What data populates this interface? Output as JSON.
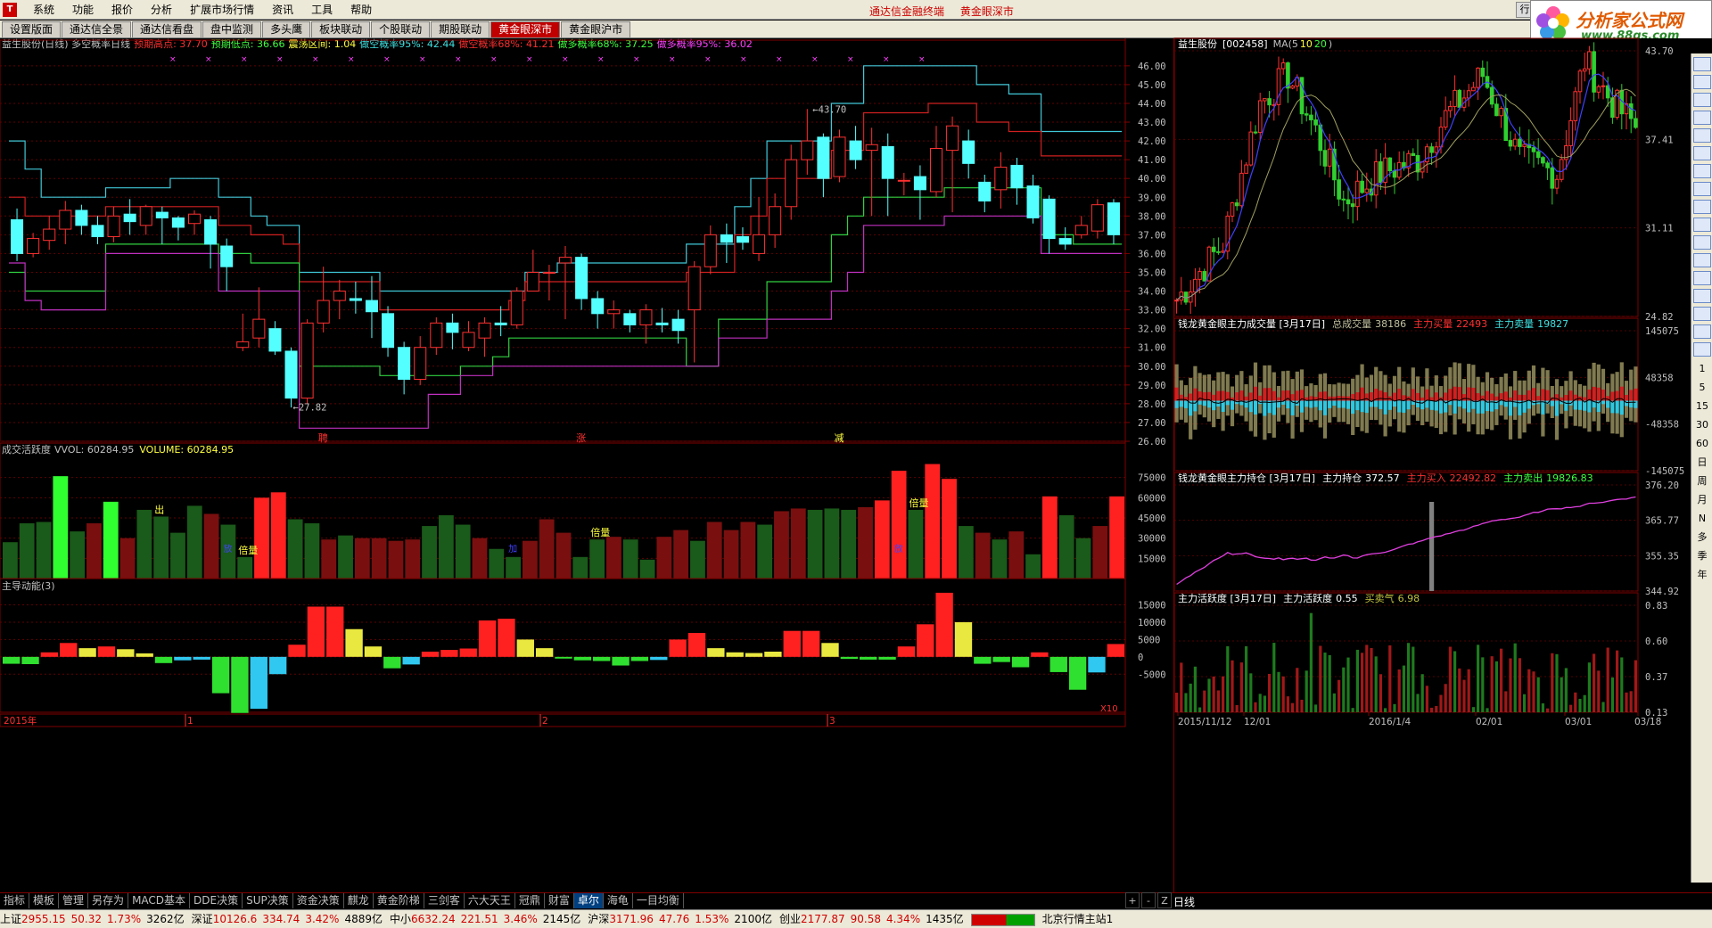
{
  "window": {
    "menus": [
      "系统",
      "功能",
      "报价",
      "分析",
      "扩展市场行情",
      "资讯",
      "工具",
      "帮助"
    ],
    "center_titles": [
      "通达信金融终端",
      "黄金眼深市"
    ],
    "win_buttons": [
      "行",
      "—",
      "□",
      "×"
    ]
  },
  "logo": {
    "text": "分析家公式网",
    "url": "www.88gs.com"
  },
  "tabs": [
    "设置版面",
    "通达信全景",
    "通达信看盘",
    "盘中监测",
    "多头鹰",
    "板块联动",
    "个股联动",
    "期股联动",
    "黄金眼深市",
    "黄金眼沪市"
  ],
  "active_tab": 8,
  "main_header": {
    "title": "益生股份(日线) 多空概率日线",
    "items": [
      {
        "text": "预期高点: 37.70",
        "color": "#ff3030"
      },
      {
        "text": "预期低点: 36.66",
        "color": "#40ff40"
      },
      {
        "text": "震荡区间: 1.04",
        "color": "#ffff40"
      },
      {
        "text": "做空概率95%: 42.44",
        "color": "#40e0e0"
      },
      {
        "text": "做空概率68%: 41.21",
        "color": "#ff3030"
      },
      {
        "text": "做多概率68%: 37.25",
        "color": "#40ff40"
      },
      {
        "text": "做多概率95%: 36.02",
        "color": "#ff40ff"
      }
    ]
  },
  "price_axis": [
    "46.00",
    "45.00",
    "44.00",
    "43.00",
    "42.00",
    "41.00",
    "40.00",
    "39.00",
    "38.00",
    "37.00",
    "36.00",
    "35.00",
    "34.00",
    "33.00",
    "32.00",
    "31.00",
    "30.00",
    "29.00",
    "28.00",
    "27.00",
    "26.00"
  ],
  "price_annot": {
    "high": "43.70",
    "low": "27.82"
  },
  "main_marks": [
    "聘",
    "涨",
    "减"
  ],
  "vol_header": {
    "title": "成交活跃度",
    "vvol": "VVOL: 60284.95",
    "volume": "VOLUME: 60284.95"
  },
  "vol_axis": [
    "75000",
    "60000",
    "45000",
    "30000",
    "15000"
  ],
  "vol_labels": [
    "出",
    "倍量",
    "倍量",
    "倍量"
  ],
  "vol_side_labels": [
    "放",
    "加",
    "放"
  ],
  "ind_header": {
    "title": "主导动能(3)"
  },
  "ind_axis": [
    "15000",
    "10000",
    "5000",
    "0",
    "-5000"
  ],
  "x_axis": {
    "labels": [
      "2015年",
      "1",
      "2",
      "3"
    ],
    "corner": "X10"
  },
  "bottom_tabs": [
    "指标",
    "模板",
    "管理",
    "另存为",
    "MACD基本",
    "DDE决策",
    "SUP决策",
    "资金决策",
    "麒龙",
    "黄金阶梯",
    "三剑客",
    "六大天王",
    "冠鼎",
    "财富",
    "卓尔",
    "海龟",
    "一目均衡"
  ],
  "bottom_active": 14,
  "bottom_ctrl": [
    "+",
    "-",
    "Z"
  ],
  "period_label": "日线",
  "right": {
    "p1_header": {
      "name": "益生股份",
      "code": "[002458]",
      "ma": "MA(",
      "ma5": "5",
      "ma10": "10",
      "ma20": "20",
      "close": ")"
    },
    "p1_axis": [
      "43.70",
      "37.41",
      "31.11",
      "24.82"
    ],
    "p2_header": {
      "title": "钱龙黄金眼主力成交量 [3月17日]",
      "total_label": "总成交量",
      "total": "38186",
      "buy_label": "主力买量",
      "buy": "22493",
      "sell_label": "主力卖量",
      "sell": "19827"
    },
    "p2_axis": [
      "145075",
      "48358",
      "-48358",
      "-145075"
    ],
    "p3_header": {
      "title": "钱龙黄金眼主力持仓 [3月17日]",
      "hold_label": "主力持仓",
      "hold": "372.57",
      "buy_label": "主力买入",
      "buy": "22492.82",
      "sell_label": "主力卖出",
      "sell": "19826.83"
    },
    "p3_axis": [
      "376.20",
      "365.77",
      "355.35",
      "344.92"
    ],
    "p4_header": {
      "title": "主力活跃度 [3月17日]",
      "act_label": "主力活跃度",
      "act": "0.55",
      "bs_label": "买卖气",
      "bs": "6.98"
    },
    "p4_axis": [
      "0.83",
      "0.60",
      "0.37",
      "0.13"
    ],
    "x_axis": [
      "2015/11/12",
      "12/01",
      "2016/1/4",
      "02/01",
      "03/01",
      "03/18"
    ]
  },
  "sidebar_periods": [
    "1",
    "5",
    "15",
    "30",
    "60",
    "日",
    "周",
    "月",
    "N",
    "多",
    "季",
    "年"
  ],
  "status": {
    "items": [
      {
        "name": "上证",
        "val": "2955.15",
        "chg": "50.32",
        "pct": "1.73%",
        "amt": "3262亿"
      },
      {
        "name": "深证",
        "val": "10126.6",
        "chg": "334.74",
        "pct": "3.42%",
        "amt": "4889亿"
      },
      {
        "name": "中小",
        "val": "6632.24",
        "chg": "221.51",
        "pct": "3.46%",
        "amt": "2145亿"
      },
      {
        "name": "沪深",
        "val": "3171.96",
        "chg": "47.76",
        "pct": "1.53%",
        "amt": "2100亿"
      },
      {
        "name": "创业",
        "val": "2177.87",
        "chg": "90.58",
        "pct": "4.34%",
        "amt": "1435亿"
      }
    ],
    "station": "北京行情主站1"
  },
  "colors": {
    "up": "#ff3030",
    "down": "#54ffff",
    "frame": "#800000",
    "grid": "#800000"
  },
  "chart_data": [
    {
      "type": "candlestick",
      "title": "益生股份(日线) 多空概率日线",
      "ylim": [
        26,
        46
      ],
      "candles": [
        [
          37.8,
          36.0,
          38.4,
          35.6
        ],
        [
          36.0,
          36.8,
          37.1,
          35.8
        ],
        [
          36.7,
          37.3,
          38.0,
          36.2
        ],
        [
          37.3,
          38.3,
          38.8,
          36.5
        ],
        [
          38.3,
          37.5,
          38.6,
          37.0
        ],
        [
          37.5,
          36.9,
          38.0,
          36.5
        ],
        [
          36.9,
          38.0,
          38.5,
          36.6
        ],
        [
          38.1,
          37.7,
          38.9,
          37.0
        ],
        [
          37.5,
          38.5,
          38.6,
          37.0
        ],
        [
          38.2,
          37.9,
          38.5,
          36.5
        ],
        [
          37.9,
          37.4,
          38.0,
          36.7
        ],
        [
          37.6,
          38.1,
          38.3,
          37.0
        ],
        [
          37.8,
          36.5,
          38.0,
          35.2
        ],
        [
          36.4,
          35.3,
          36.8,
          34.0
        ],
        [
          31.0,
          31.3,
          32.8,
          30.8
        ],
        [
          31.5,
          32.5,
          34.2,
          31.0
        ],
        [
          32.0,
          30.8,
          32.4,
          30.6
        ],
        [
          30.8,
          28.3,
          31.0,
          27.8
        ],
        [
          28.3,
          32.3,
          32.5,
          28.0
        ],
        [
          32.3,
          33.5,
          35.3,
          31.8
        ],
        [
          33.5,
          34.0,
          34.6,
          32.5
        ],
        [
          33.6,
          33.5,
          34.5,
          32.8
        ],
        [
          33.5,
          32.9,
          34.8,
          31.5
        ],
        [
          32.8,
          31.0,
          33.2,
          30.5
        ],
        [
          31.0,
          29.3,
          31.3,
          28.5
        ],
        [
          29.3,
          31.0,
          31.6,
          29.0
        ],
        [
          31.0,
          32.3,
          32.6,
          30.6
        ],
        [
          32.3,
          31.8,
          32.8,
          30.9
        ],
        [
          31.0,
          31.8,
          32.4,
          30.8
        ],
        [
          31.5,
          32.3,
          32.6,
          30.5
        ],
        [
          32.3,
          32.2,
          33.2,
          31.6
        ],
        [
          32.2,
          34.0,
          34.2,
          32.0
        ],
        [
          34.0,
          35.0,
          36.2,
          34.0
        ],
        [
          35.0,
          35.0,
          35.4,
          33.5
        ],
        [
          35.5,
          35.8,
          36.4,
          32.5
        ],
        [
          35.8,
          33.6,
          36.0,
          33.0
        ],
        [
          33.6,
          32.8,
          34.0,
          32.0
        ],
        [
          32.8,
          33.0,
          33.5,
          32.0
        ],
        [
          32.8,
          32.2,
          33.0,
          31.8
        ],
        [
          32.2,
          33.0,
          33.3,
          31.2
        ],
        [
          32.3,
          32.2,
          33.1,
          31.8
        ],
        [
          32.5,
          31.9,
          33.0,
          31.2
        ],
        [
          33.0,
          35.3,
          35.6,
          30.2
        ],
        [
          35.3,
          37.0,
          37.5,
          34.9
        ],
        [
          37.0,
          36.6,
          37.6,
          35.5
        ],
        [
          36.9,
          36.6,
          37.4,
          36.2
        ],
        [
          36.0,
          37.0,
          39.0,
          35.6
        ],
        [
          37.0,
          38.5,
          39.2,
          36.3
        ],
        [
          38.5,
          41.0,
          41.8,
          37.8
        ],
        [
          41.0,
          42.0,
          43.7,
          40.2
        ],
        [
          42.2,
          40.0,
          42.4,
          39.0
        ],
        [
          40.1,
          42.2,
          42.6,
          39.8
        ],
        [
          42.0,
          41.0,
          42.8,
          40.5
        ],
        [
          41.5,
          41.8,
          42.7,
          38.0
        ],
        [
          41.7,
          40.0,
          42.4,
          38.0
        ],
        [
          39.9,
          39.9,
          40.3,
          39.1
        ],
        [
          40.1,
          39.4,
          40.7,
          37.8
        ],
        [
          39.3,
          41.6,
          42.8,
          39.0
        ],
        [
          41.5,
          42.8,
          43.3,
          38.2
        ],
        [
          42.0,
          40.8,
          42.6,
          40.0
        ],
        [
          39.8,
          38.8,
          40.2,
          38.2
        ],
        [
          39.4,
          40.6,
          41.4,
          38.4
        ],
        [
          40.7,
          39.5,
          41.1,
          38.6
        ],
        [
          39.6,
          37.9,
          40.2,
          37.6
        ],
        [
          38.9,
          36.8,
          39.1,
          36.0
        ],
        [
          36.8,
          36.5,
          37.4,
          36.2
        ],
        [
          37.0,
          37.5,
          38.0,
          36.8
        ],
        [
          37.2,
          38.6,
          38.9,
          36.8
        ],
        [
          38.7,
          37.0,
          38.9,
          36.5
        ]
      ],
      "bands": {
        "short95": [
          42.0,
          40.5,
          39.0,
          39.0,
          39.0,
          39.0,
          39.5,
          39.5,
          39.5,
          39.5,
          40.0,
          40.0,
          40.0,
          39.0,
          39.0,
          38.0,
          37.5,
          37.5,
          35.0,
          35.0,
          35.0,
          35.0,
          35.0,
          34.0,
          34.0,
          34.0,
          34.0,
          34.0,
          34.0,
          34.0,
          34.0,
          34.0,
          35.0,
          35.0,
          35.5,
          35.5,
          35.5,
          35.5,
          35.5,
          35.5,
          35.5,
          35.5,
          36.5,
          36.5,
          36.5,
          38.5,
          40.0,
          42.0,
          42.0,
          42.0,
          42.0,
          44.0,
          44.0,
          46.0,
          46.0,
          46.0,
          46.0,
          46.0,
          46.0,
          46.0,
          45.0,
          45.0,
          44.5,
          44.5,
          42.5,
          42.5,
          42.5,
          42.5,
          42.5
        ],
        "short68": [
          39.0,
          38.0,
          38.0,
          38.0,
          38.0,
          38.0,
          38.5,
          38.5,
          38.5,
          38.5,
          38.5,
          38.5,
          38.5,
          37.5,
          37.5,
          37.0,
          37.0,
          36.5,
          34.5,
          34.5,
          34.5,
          34.5,
          34.5,
          33.0,
          33.0,
          33.0,
          33.0,
          33.0,
          33.0,
          33.0,
          33.0,
          33.5,
          34.5,
          34.5,
          34.5,
          34.5,
          34.5,
          34.5,
          34.5,
          34.5,
          34.5,
          34.5,
          35.0,
          35.0,
          35.0,
          37.0,
          38.0,
          40.0,
          40.0,
          40.0,
          40.0,
          41.5,
          41.5,
          43.5,
          43.5,
          43.5,
          43.5,
          44.0,
          44.0,
          44.0,
          43.0,
          43.0,
          42.5,
          42.5,
          41.2,
          41.2,
          41.2,
          41.2,
          41.2
        ],
        "long68": [
          35.0,
          34.0,
          34.0,
          34.0,
          34.0,
          34.0,
          36.5,
          36.5,
          36.5,
          36.5,
          36.5,
          36.5,
          36.5,
          36.0,
          36.0,
          35.5,
          35.5,
          35.5,
          30.0,
          30.0,
          30.0,
          30.0,
          30.0,
          29.5,
          29.5,
          29.5,
          29.5,
          29.5,
          30.0,
          30.0,
          30.5,
          31.5,
          31.5,
          31.5,
          31.5,
          31.5,
          31.5,
          31.5,
          31.5,
          31.5,
          31.5,
          31.5,
          30.0,
          30.0,
          32.5,
          32.5,
          32.5,
          34.5,
          34.5,
          34.5,
          34.5,
          37.0,
          38.0,
          39.0,
          39.0,
          39.0,
          39.0,
          39.0,
          39.5,
          39.5,
          39.5,
          39.5,
          39.5,
          39.5,
          37.0,
          37.0,
          36.5,
          36.5,
          36.5
        ],
        "long95": [
          35.5,
          33.5,
          33.0,
          33.0,
          33.0,
          33.0,
          36.0,
          36.0,
          36.0,
          36.0,
          36.0,
          36.0,
          36.0,
          34.0,
          34.0,
          34.0,
          34.0,
          34.0,
          26.7,
          26.7,
          26.7,
          26.7,
          26.7,
          26.7,
          26.7,
          26.7,
          28.5,
          28.5,
          29.5,
          29.5,
          30.0,
          30.0,
          30.0,
          30.0,
          30.0,
          30.0,
          30.0,
          30.0,
          30.0,
          30.0,
          30.0,
          30.0,
          30.0,
          30.0,
          31.5,
          31.5,
          31.5,
          32.5,
          32.5,
          32.5,
          32.5,
          34.0,
          35.0,
          37.5,
          37.5,
          37.5,
          37.5,
          37.5,
          38.0,
          38.0,
          38.0,
          38.0,
          38.0,
          38.0,
          36.0,
          36.0,
          36.0,
          36.0,
          36.0
        ]
      }
    },
    {
      "type": "bar",
      "title": "成交活跃度",
      "ylim": [
        0,
        90000
      ],
      "values": [
        27000,
        41000,
        42000,
        76000,
        35000,
        41000,
        57000,
        30000,
        51000,
        46000,
        34000,
        54000,
        48000,
        40000,
        16000,
        60000,
        64000,
        44000,
        41000,
        29000,
        32000,
        30000,
        30000,
        28000,
        29000,
        39000,
        47000,
        40000,
        30000,
        22000,
        16000,
        28000,
        44000,
        34000,
        16000,
        29000,
        31000,
        29000,
        14000,
        31000,
        36000,
        28000,
        42000,
        36000,
        42000,
        40000,
        50000,
        52000,
        51000,
        52000,
        51000,
        53000,
        58000,
        80000,
        51000,
        85000,
        74000,
        39000,
        34000,
        29000,
        35000,
        18000,
        61000,
        47000,
        30000,
        39000,
        61000
      ],
      "ups": [
        0,
        0,
        0,
        0,
        0,
        1,
        0,
        1,
        0,
        0,
        0,
        0,
        1,
        0,
        0,
        1,
        1,
        0,
        0,
        1,
        0,
        1,
        1,
        1,
        1,
        0,
        0,
        0,
        1,
        0,
        0,
        1,
        1,
        1,
        0,
        0,
        1,
        0,
        0,
        1,
        1,
        0,
        1,
        1,
        1,
        0,
        1,
        1,
        0,
        0,
        0,
        1,
        1,
        1,
        0,
        1,
        1,
        0,
        1,
        0,
        1,
        0,
        1,
        0,
        0,
        1,
        1
      ]
    },
    {
      "type": "bar",
      "title": "主导动能(3)",
      "ylim": [
        -16000,
        19000
      ],
      "values": [
        -2000,
        -2100,
        1300,
        4000,
        2500,
        3000,
        2200,
        1000,
        -1800,
        -1000,
        -800,
        -10500,
        -16200,
        -15000,
        -5000,
        3500,
        14500,
        14500,
        8000,
        3000,
        -3300,
        -2200,
        1500,
        2000,
        2400,
        10500,
        11000,
        5000,
        2500,
        -500,
        -1000,
        -1200,
        -2500,
        -1200,
        -900,
        5000,
        6900,
        2500,
        1300,
        1100,
        1500,
        7500,
        7500,
        4000,
        -600,
        -800,
        -800,
        3000,
        9400,
        18500,
        10000,
        -2000,
        -1500,
        -3000,
        1300,
        -4400,
        -9500,
        -4500,
        3700
      ],
      "colors": [
        1,
        1,
        0,
        0,
        2,
        0,
        2,
        2,
        1,
        3,
        3,
        1,
        1,
        3,
        3,
        0,
        0,
        0,
        2,
        2,
        1,
        3,
        0,
        0,
        0,
        0,
        0,
        2,
        2,
        1,
        1,
        1,
        1,
        1,
        3,
        0,
        0,
        2,
        2,
        2,
        2,
        0,
        0,
        2,
        1,
        1,
        1,
        0,
        0,
        0,
        2,
        1,
        1,
        1,
        0,
        1,
        1,
        3,
        0
      ]
    }
  ]
}
